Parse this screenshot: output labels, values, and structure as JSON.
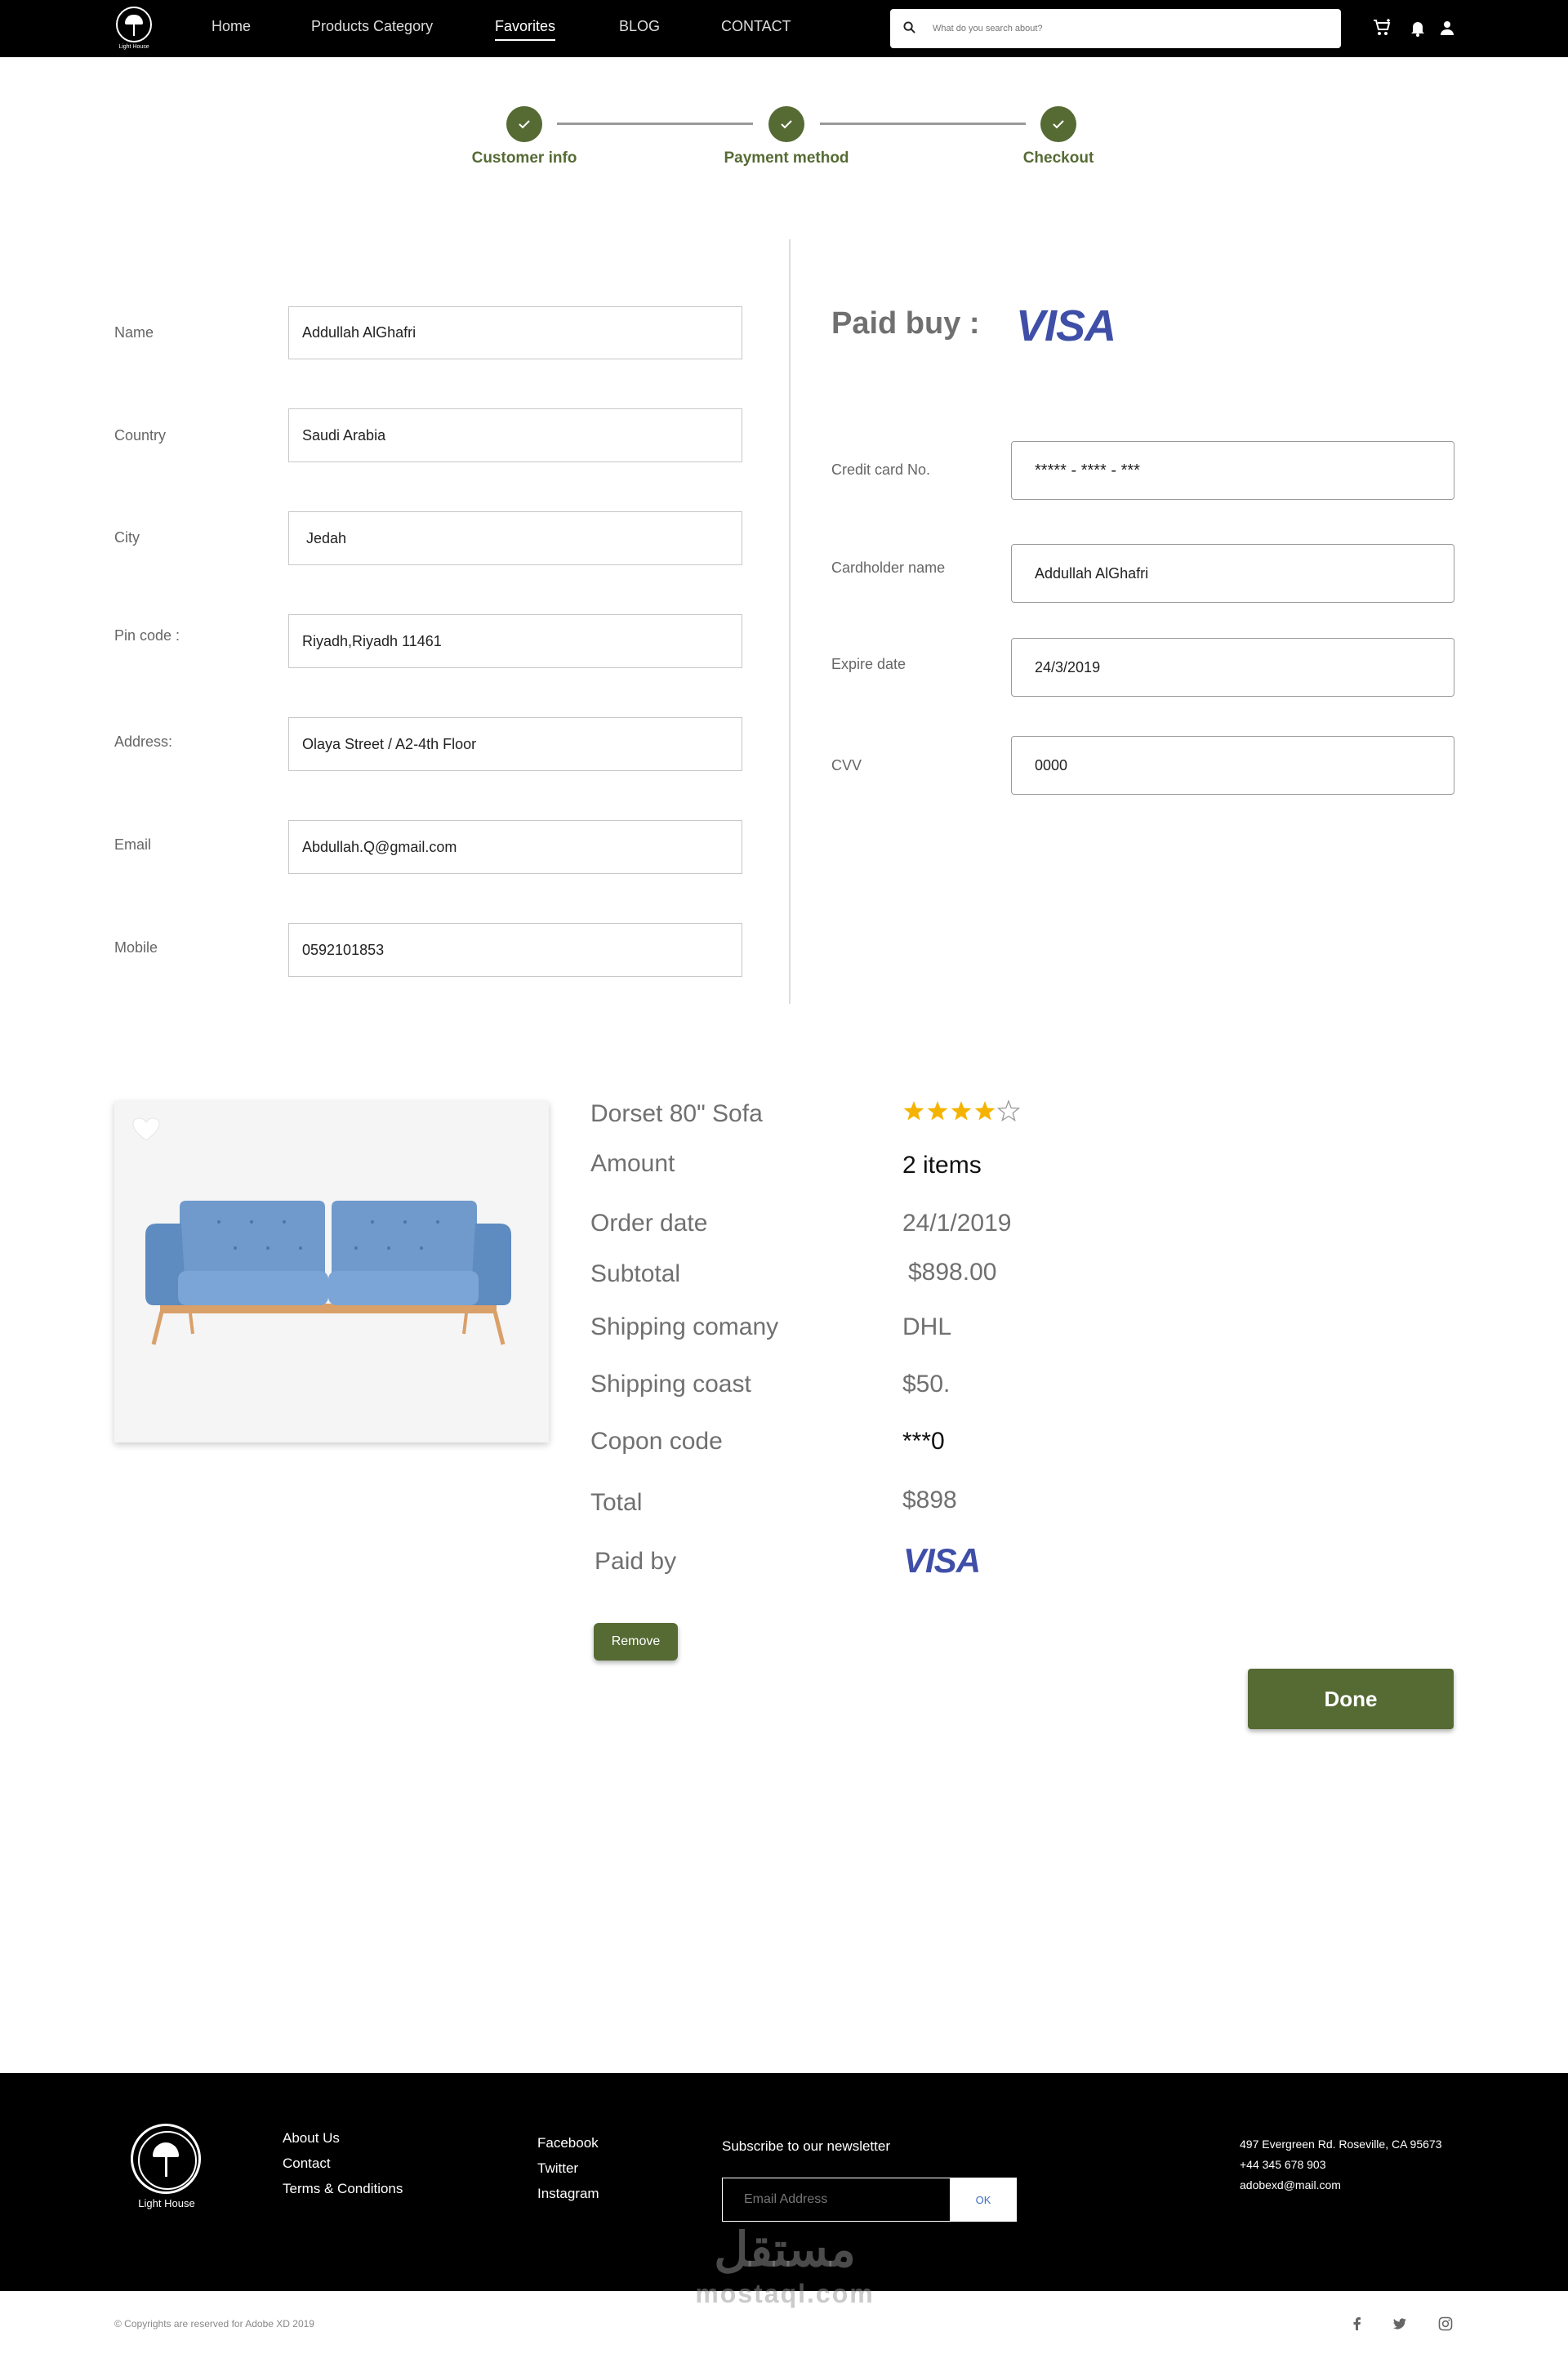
{
  "header": {
    "logo_caption": "Light House",
    "nav": [
      "Home",
      "Products Category",
      "Favorites",
      "BLOG",
      "CONTACT"
    ],
    "active_nav": "Favorites",
    "search_placeholder": "What do you search about?"
  },
  "stepper": {
    "steps": [
      "Customer info",
      "Payment method",
      "Checkout"
    ]
  },
  "customer_form": {
    "name_label": "Name",
    "name_value": "Addullah AlGhafri",
    "country_label": "Country",
    "country_value": "Saudi Arabia",
    "city_label": "City",
    "city_value": " Jedah",
    "pin_label": "Pin code :",
    "pin_value": "Riyadh,Riyadh 11461",
    "address_label": "Address:",
    "address_value": "Olaya Street / A2-4th Floor",
    "email_label": "Email",
    "email_value": "Abdullah.Q@gmail.com",
    "mobile_label": "Mobile",
    "mobile_value": "0592101853"
  },
  "payment": {
    "title": "Paid buy :",
    "brand": "VISA",
    "card_label": "Credit card No.",
    "card_value": "***** - **** - ***",
    "holder_label": "Cardholder name",
    "holder_value": "Addullah AlGhafri",
    "expire_label": "Expire date",
    "expire_value": "24/3/2019",
    "cvv_label": "CVV",
    "cvv_value": "0000"
  },
  "order": {
    "product_name": "Dorset 80\" Sofa",
    "rating": 4,
    "rating_max": 5,
    "amount_label": "Amount",
    "amount_value": "2 items",
    "date_label": "Order date",
    "date_value": "24/1/2019",
    "subtotal_label": "Subtotal",
    "subtotal_value": "$898.00",
    "shipping_company_label": "Shipping comany",
    "shipping_company_value": "DHL",
    "shipping_cost_label": "Shipping coast",
    "shipping_cost_value": "$50.",
    "coupon_label": "Copon code",
    "coupon_value": "***0",
    "total_label": "Total",
    "total_value": "$898",
    "paid_by_label": "Paid by",
    "paid_by_value": "VISA",
    "remove_label": "Remove",
    "done_label": "Done"
  },
  "footer": {
    "logo_caption": "Light House",
    "links1": [
      "About Us",
      "Contact",
      "Terms & Conditions"
    ],
    "links2": [
      "Facebook",
      "Twitter",
      "Instagram"
    ],
    "newsletter_title": "Subscribe to our newsletter",
    "email_placeholder": "Email Address",
    "ok_label": "OK",
    "address": [
      "497 Evergreen Rd. Roseville, CA 95673",
      "+44 345 678 903",
      "adobexd@mail.com"
    ],
    "copyright": "© Copyrights are reserved for Adobe XD 2019"
  },
  "watermark": {
    "arabic": "مستقل",
    "latin": "mostaql.com"
  },
  "colors": {
    "accent": "#566b34",
    "visa": "#3f4fa8",
    "star": "#f5b301"
  }
}
